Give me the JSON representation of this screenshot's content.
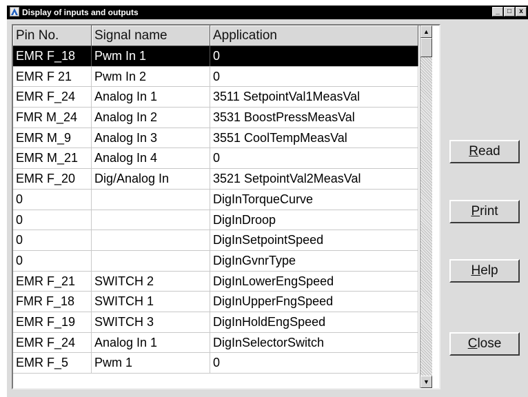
{
  "window": {
    "title": "Display of inputs and outputs",
    "controls": {
      "minimize": "_",
      "maximize": "□",
      "close": "x"
    }
  },
  "table": {
    "columns": [
      "Pin No.",
      "Signal name",
      "Application"
    ],
    "selected_row": 0,
    "rows": [
      [
        "EMR F_18",
        "Pwm In 1",
        "0"
      ],
      [
        "EMR F 21",
        "Pwm In 2",
        "0"
      ],
      [
        "EMR F_24",
        "Analog In 1",
        "3511 SetpointVal1MeasVal"
      ],
      [
        "FMR M_24",
        "Analog In 2",
        "3531 BoostPressMeasVal"
      ],
      [
        "EMR M_9",
        "Analog In 3",
        "3551 CoolTempMeasVal"
      ],
      [
        "EMR M_21",
        "Analog In 4",
        "0"
      ],
      [
        "EMR F_20",
        "Dig/Analog In",
        "3521 SetpointVal2MeasVal"
      ],
      [
        "0",
        "",
        "DigInTorqueCurve"
      ],
      [
        "0",
        "",
        "DigInDroop"
      ],
      [
        "0",
        "",
        "DigInSetpointSpeed"
      ],
      [
        "0",
        "",
        "DigInGvnrType"
      ],
      [
        "EMR F_21",
        "SWITCH 2",
        "DigInLowerEngSpeed"
      ],
      [
        "FMR F_18",
        "SWITCH 1",
        "DigInUpperFngSpeed"
      ],
      [
        "EMR F_19",
        "SWITCH 3",
        "DigInHoldEngSpeed"
      ],
      [
        "EMR F_24",
        "Analog In 1",
        "DigInSelectorSwitch"
      ],
      [
        "EMR F_5",
        "Pwm 1",
        "0"
      ]
    ]
  },
  "scrollbar": {
    "up_icon": "arrow-up-icon",
    "down_icon": "arrow-down-icon"
  },
  "buttons": {
    "read": {
      "mnemonic": "R",
      "rest": "ead"
    },
    "print": {
      "mnemonic": "P",
      "rest": "rint"
    },
    "help": {
      "mnemonic": "H",
      "rest": "elp"
    },
    "close": {
      "mnemonic": "C",
      "rest": "lose"
    }
  }
}
